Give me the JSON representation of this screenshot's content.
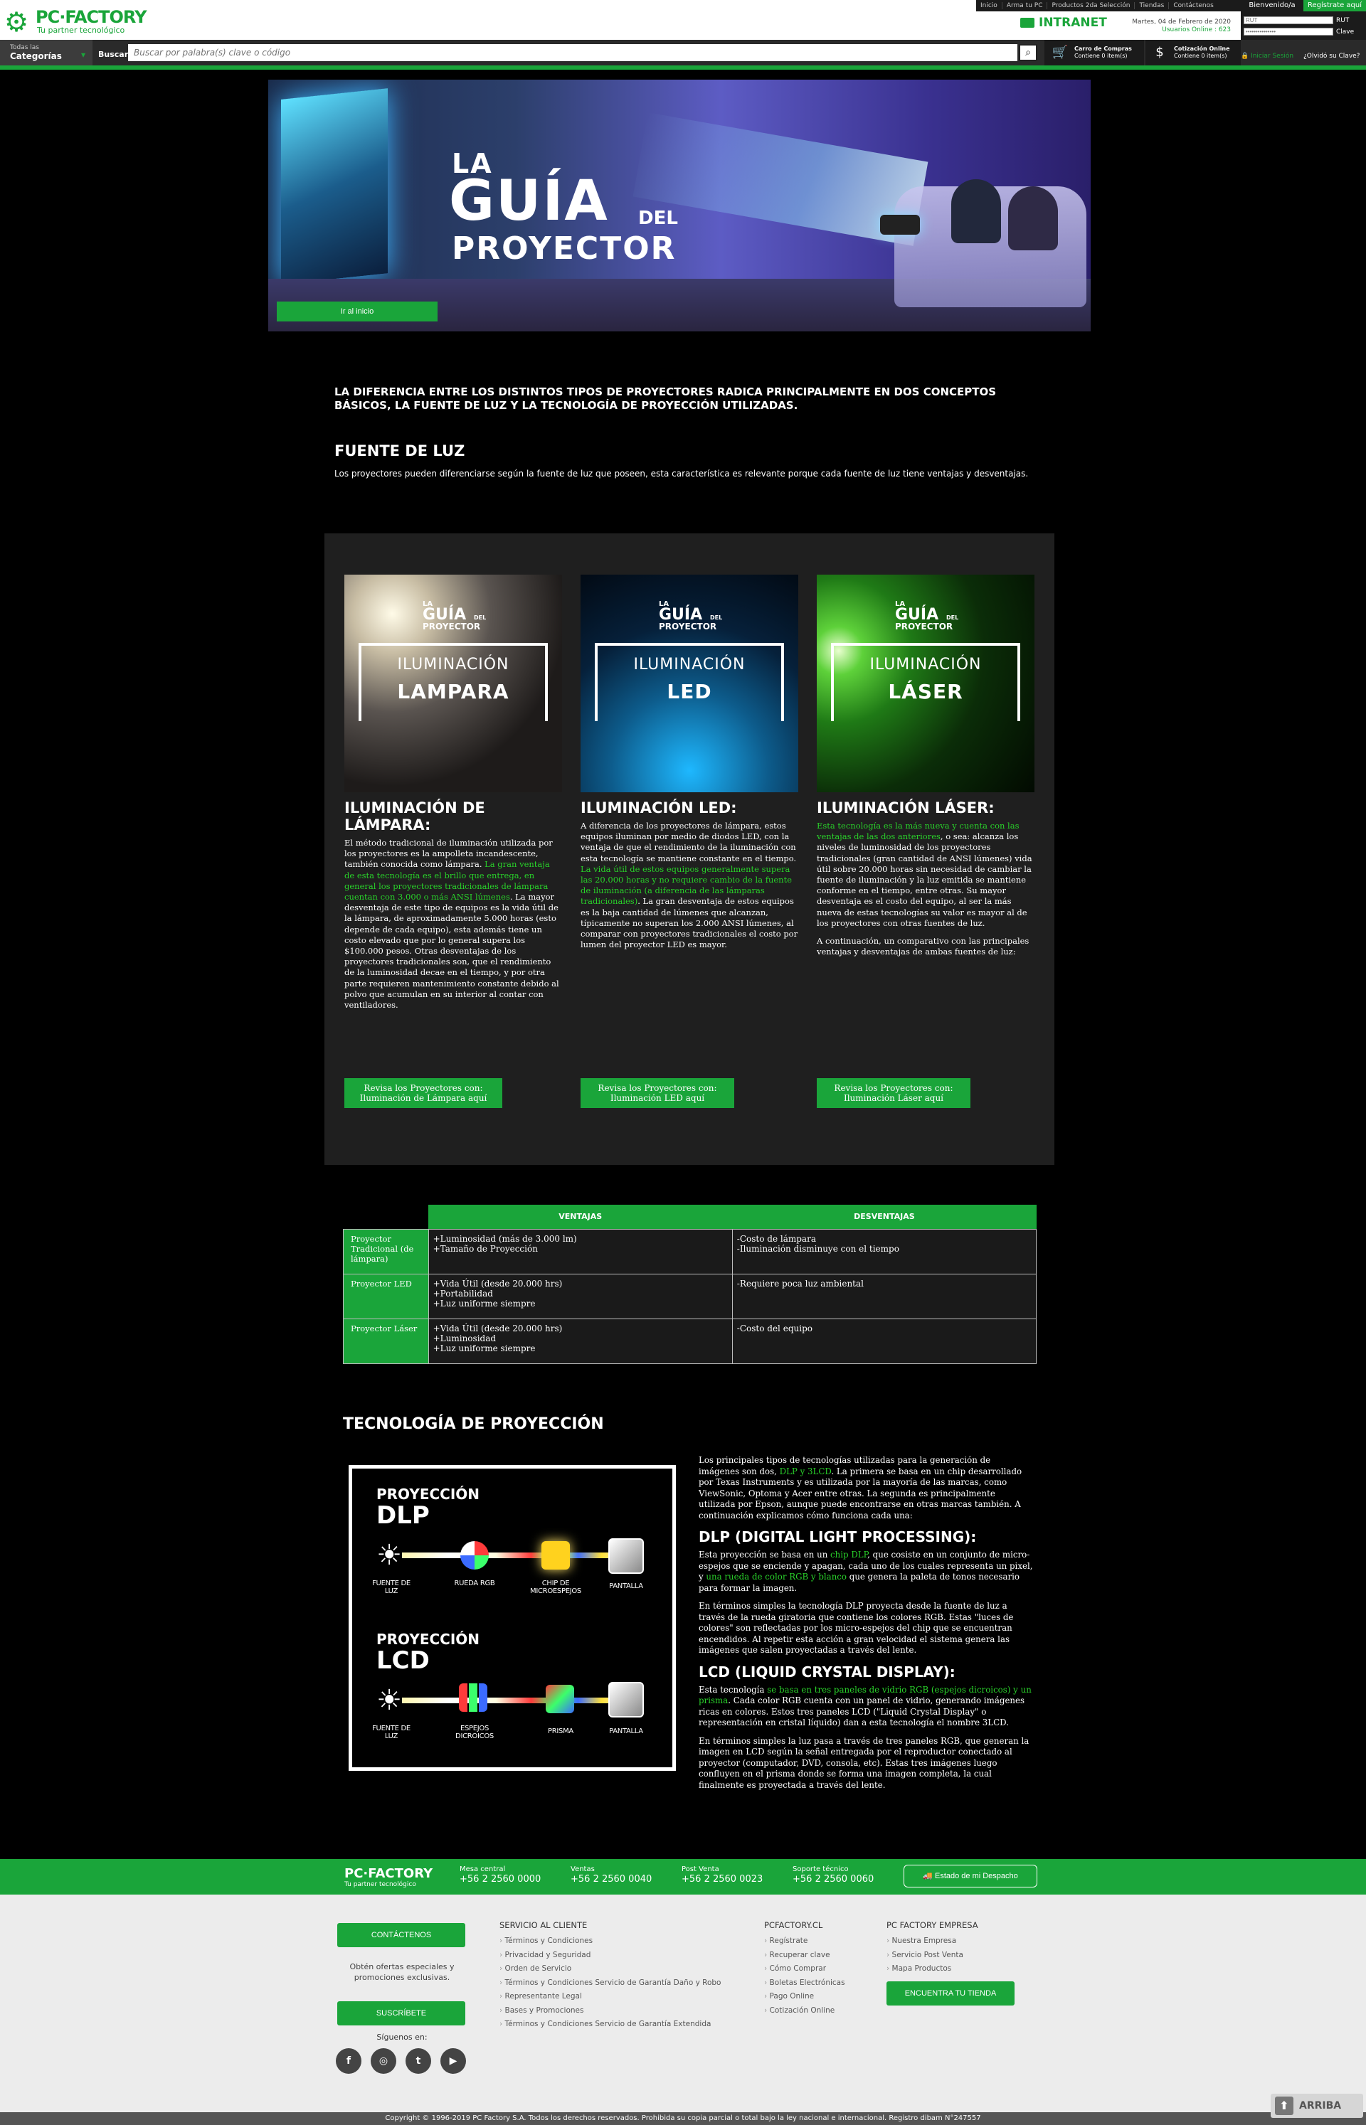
{
  "header": {
    "logo_name": "PC·FACTORY",
    "logo_tagline": "Tu partner tecnológico",
    "topnav": [
      "Inicio",
      "Arma tu PC",
      "Productos 2da Selección",
      "Tiendas",
      "Contáctenos"
    ],
    "welcome": "Bienvenido/a",
    "register": "Regístrate aquí",
    "intranet": "INTRANET",
    "date": "Martes, 04 de Febrero de 2020",
    "online": "Usuarios Online : 623",
    "rut_placeholder": "RUT",
    "rut_label": "RUT",
    "pass_placeholder": "•••••••••••••••",
    "pass_label": "Clave",
    "categories_small": "Todas las",
    "categories_big": "Categorías",
    "search_label": "Buscar:",
    "search_placeholder": "Buscar por palabra(s) clave o código",
    "cart_l1": "Carro de Compras",
    "cart_l2": "Contiene 0 item(s)",
    "quote_l1": "Cotización Online",
    "quote_l2": "Contiene 0 item(s)",
    "signin": "Iniciar Sesión",
    "forgot": "¿Olvidó su Clave?"
  },
  "hero": {
    "la": "LA",
    "guia": "GUÍA",
    "del": "DEL",
    "proyector": "PROYECTOR",
    "button": "Ir al inicio"
  },
  "intro": "LA DIFERENCIA ENTRE LOS DISTINTOS TIPOS DE PROYECTORES RADICA PRINCIPALMENTE EN DOS CONCEPTOS BÁSICOS, LA FUENTE DE LUZ Y LA TECNOLOGÍA DE PROYECCIÓN UTILIZADAS.",
  "fuente": {
    "title": "FUENTE DE LUZ",
    "text": "Los proyectores pueden diferenciarse según la fuente de luz que poseen, esta característica es relevante porque cada fuente de luz tiene ventajas y desventajas."
  },
  "cards": [
    {
      "img_la": "LA",
      "img_guia": "GUÍA",
      "img_del": "DEL",
      "img_proy": "PROYECTOR",
      "img_iluminacion": "ILUMINACIÓN",
      "img_tipo": "LAMPARA",
      "title": "ILUMINACIÓN DE LÁMPARA:",
      "t1": "El método tradicional de iluminación utilizada por los proyectores es la ampolleta incandescente, también conocida como lámpara. ",
      "g1": "La gran ventaja de esta tecnología es el brillo que entrega, en general los proyectores tradicionales de lámpara cuentan con 3.000 o más ANSI lúmenes",
      "t2": ". La mayor desventaja de este tipo de equipos es la vida útil de la lámpara, de aproximadamente 5.000 horas (esto depende de cada equipo), esta además tiene un costo elevado que por lo general supera los $100.000 pesos. Otras desventajas de los proyectores tradicionales son, que el rendimiento de la luminosidad decae en el tiempo, y por otra parte requieren mantenimiento constante debido al polvo que acumulan en su interior al contar con ventiladores.",
      "button": "Revisa los Proyectores con: Iluminación de Lámpara aquí"
    },
    {
      "img_la": "LA",
      "img_guia": "GUÍA",
      "img_del": "DEL",
      "img_proy": "PROYECTOR",
      "img_iluminacion": "ILUMINACIÓN",
      "img_tipo": "LED",
      "title": "ILUMINACIÓN LED:",
      "t1": "A diferencia de los proyectores de lámpara, estos equipos iluminan por medio de diodos LED, con la ventaja de que el rendimiento de la iluminación con esta tecnología se mantiene constante en el tiempo. ",
      "g1": "La vida útil de estos equipos generalmente supera las 20.000 horas y no requiere cambio de la fuente de iluminación (a diferencia de las lámparas tradicionales)",
      "t2": ". La gran desventaja de estos equipos es la baja cantidad de lúmenes que alcanzan, típicamente no superan los 2.000 ANSI lúmenes, al comparar con proyectores tradicionales el costo por lumen del proyector LED es mayor.",
      "button": "Revisa los Proyectores con: Iluminación LED aquí"
    },
    {
      "img_la": "LA",
      "img_guia": "GUÍA",
      "img_del": "DEL",
      "img_proy": "PROYECTOR",
      "img_iluminacion": "ILUMINACIÓN",
      "img_tipo": "LÁSER",
      "title": "ILUMINACIÓN LÁSER:",
      "g1": "Esta tecnología es la más nueva y cuenta con las ventajas de las dos anteriores",
      "t2": ", o sea: alcanza los niveles de luminosidad de los proyectores tradicionales (gran cantidad de ANSI lúmenes) vida útil sobre 20.000 horas sin necesidad de cambiar la fuente de iluminación y la luz emitida se mantiene conforme en el tiempo, entre otras. Su mayor desventaja es el costo del equipo, al ser la más nueva de estas tecnologías su valor es mayor al de los proyectores con otras fuentes de luz.",
      "t3": "A continuación, un comparativo con las principales ventajas y desventajas de ambas fuentes de luz:",
      "button": "Revisa los Proyectores con: Iluminación Láser aquí"
    }
  ],
  "table": {
    "col_ventajas": "VENTAJAS",
    "col_desventajas": "DESVENTAJAS",
    "rows": [
      {
        "label": "Proyector Tradicional (de lámpara)",
        "ventajas": "+Luminosidad (más de 3.000 lm)\n+Tamaño de Proyección",
        "desventajas": "-Costo de lámpara\n-Iluminación disminuye con el tiempo"
      },
      {
        "label": "Proyector LED",
        "ventajas": "+Vida Útil (desde 20.000 hrs)\n+Portabilidad\n+Luz uniforme siempre",
        "desventajas": "-Requiere poca luz ambiental"
      },
      {
        "label": "Proyector Láser",
        "ventajas": "+Vida Útil (desde 20.000 hrs)\n+Luminosidad\n+Luz uniforme siempre",
        "desventajas": "-Costo del equipo"
      }
    ]
  },
  "tecnologia": {
    "title": "TECNOLOGÍA DE PROYECCIÓN",
    "diagram": {
      "dlp_t1": "PROYECCIÓN",
      "dlp_t2": "DLP",
      "lcd_t1": "PROYECCIÓN",
      "lcd_t2": "LCD",
      "dlp_labels": [
        "FUENTE DE LUZ",
        "RUEDA RGB",
        "CHIP DE MICROESPEJOS",
        "PANTALLA"
      ],
      "lcd_labels": [
        "FUENTE DE LUZ",
        "ESPEJOS DICROICOS",
        "PRISMA",
        "PANTALLA"
      ]
    },
    "p1a": "Los principales tipos de tecnologías utilizadas para la generación de imágenes son dos, ",
    "p1g": "DLP y 3LCD",
    "p1b": ". La primera se basa en un chip desarrollado por Texas Instruments y es utilizada por la mayoría de las marcas, como ViewSonic, Optoma y Acer entre otras. La segunda es principalmente utilizada por Epson, aunque puede encontrarse en otras marcas también. A continuación explicamos cómo funciona cada una:",
    "h_dlp": "DLP (DIGITAL LIGHT PROCESSING):",
    "p2a": "Esta proyección se basa en un ",
    "p2g1": "chip DLP",
    "p2b": ", que cosiste en un conjunto de micro-espejos que se enciende y apagan, cada uno de los cuales representa un pixel, y ",
    "p2g2": "una rueda de color RGB y blanco",
    "p2c": " que genera la paleta de tonos necesario para formar la imagen.",
    "p3": "En términos simples la tecnología DLP proyecta desde la fuente de luz a través de la rueda giratoria que contiene los colores RGB. Estas \"luces de colores\" son reflectadas por los micro-espejos del chip que se encuentran encendidos. Al repetir esta acción a gran velocidad el sistema genera las imágenes que salen proyectadas a través del lente.",
    "h_lcd": "LCD (LIQUID CRYSTAL DISPLAY):",
    "p4a": "Esta tecnología ",
    "p4g": "se basa en tres paneles de vidrio RGB (espejos dicroicos) y un prisma",
    "p4b": ". Cada color RGB cuenta con un panel de vidrio, generando imágenes ricas en colores. Estos tres paneles LCD (\"Liquid Crystal Display\" o representación en cristal líquido) dan a esta tecnología el nombre 3LCD.",
    "p5": "En términos simples la luz pasa a través de tres paneles RGB, que generan la imagen en LCD según la señal entregada por el reproductor conectado al proyector (computador, DVD, consola, etc). Estas tres imágenes luego confluyen en el prisma donde se forma una imagen completa, la cual finalmente es proyectada a través del lente."
  },
  "footer": {
    "logo_name": "PC·FACTORY",
    "logo_tagline": "Tu partner tecnológico",
    "contacts": [
      {
        "label": "Mesa central",
        "number": "+56 2 2560 0000"
      },
      {
        "label": "Ventas",
        "number": "+56 2 2560 0040"
      },
      {
        "label": "Post Venta",
        "number": "+56 2 2560 0023"
      },
      {
        "label": "Soporte técnico",
        "number": "+56 2 2560 0060"
      }
    ],
    "shipping": "Estado de mi Despacho",
    "contact_btn": "CONTÁCTENOS",
    "promo": "Obtén ofertas especiales y promociones exclusivas.",
    "subscribe_btn": "SUSCRÍBETE",
    "follow": "Síguenos en:",
    "service_title": "SERVICIO AL CLIENTE",
    "service": [
      "Términos y Condiciones",
      "Privacidad y Seguridad",
      "Orden de Servicio",
      "Términos y Condiciones Servicio de Garantía Daño y Robo",
      "Representante Legal",
      "Bases y Promociones",
      "Términos y Condiciones Servicio de Garantía Extendida"
    ],
    "pcf_title": "PCFACTORY.CL",
    "pcf": [
      "Regístrate",
      "Recuperar clave",
      "Cómo Comprar",
      "Boletas Electrónicas",
      "Pago Online",
      "Cotización Online"
    ],
    "emp_title": "PC FACTORY EMPRESA",
    "emp": [
      "Nuestra Empresa",
      "Servicio Post Venta",
      "Mapa Productos"
    ],
    "store_btn": "ENCUENTRA TU TIENDA",
    "copyright": "Copyright © 1996-2019 PC Factory S.A. Todos los derechos reservados. Prohibida su copia parcial o total bajo la ley nacional e internacional. Registro dibam N°247557",
    "arriba": "ARRIBA"
  },
  "colors": {
    "brand": "#1aa53a",
    "highlight": "#29d12a"
  }
}
